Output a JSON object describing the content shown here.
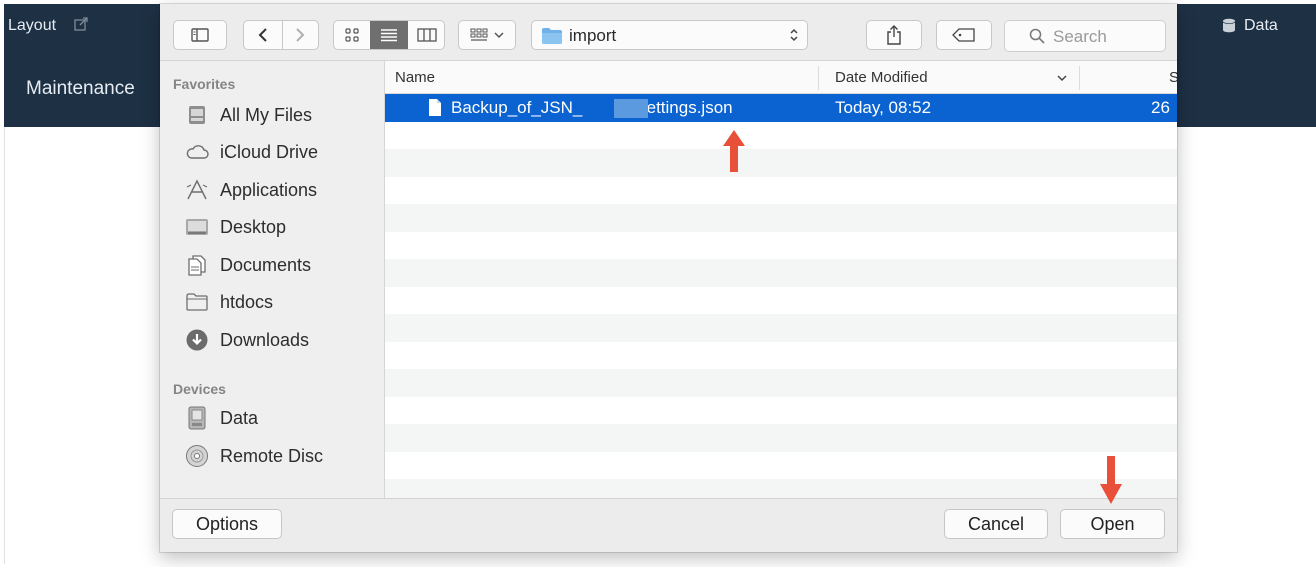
{
  "background_app": {
    "layout_label": "Layout",
    "data_label": "Data",
    "maintenance_label": "Maintenance"
  },
  "toolbar": {
    "path_folder": "import",
    "search_placeholder": "Search"
  },
  "sidebar": {
    "favorites_heading": "Favorites",
    "favorites": [
      {
        "label": "All My Files",
        "icon": "all-files-icon"
      },
      {
        "label": "iCloud Drive",
        "icon": "cloud-icon"
      },
      {
        "label": "Applications",
        "icon": "applications-icon"
      },
      {
        "label": "Desktop",
        "icon": "desktop-icon"
      },
      {
        "label": "Documents",
        "icon": "documents-icon"
      },
      {
        "label": "htdocs",
        "icon": "folder-icon"
      },
      {
        "label": "Downloads",
        "icon": "downloads-icon"
      }
    ],
    "devices_heading": "Devices",
    "devices": [
      {
        "label": "Data",
        "icon": "disk-icon"
      },
      {
        "label": "Remote Disc",
        "icon": "disc-icon"
      }
    ]
  },
  "file_list": {
    "columns": {
      "name": "Name",
      "date_modified": "Date Modified",
      "size_partial": "S"
    },
    "selected_file": {
      "name_prefix": "Backup_of_JSN_",
      "name_suffix": "2_Settings.json",
      "date": "Today, 08:52",
      "size_partial": "26"
    }
  },
  "footer": {
    "options_label": "Options",
    "cancel_label": "Cancel",
    "open_label": "Open"
  },
  "colors": {
    "selection": "#0b63d1",
    "annotation_arrow": "#e8503a",
    "background_nav": "#1e3044"
  }
}
